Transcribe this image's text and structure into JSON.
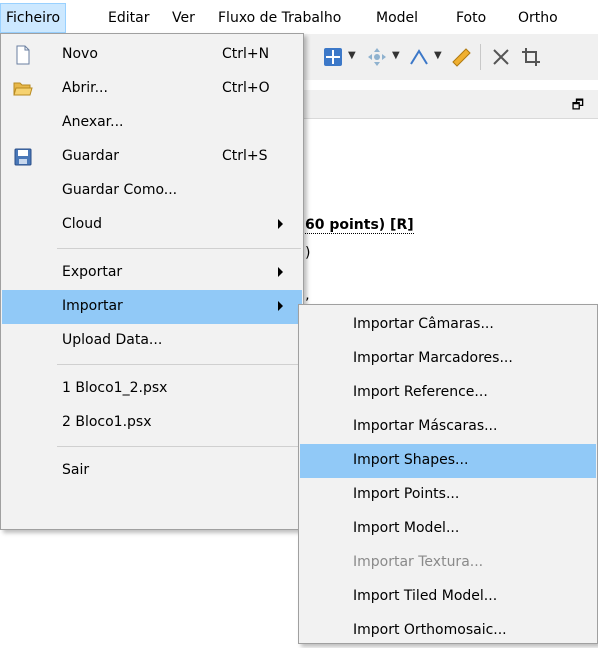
{
  "menubar": {
    "items": [
      "Ficheiro",
      "Editar",
      "Ver",
      "Fluxo de Trabalho",
      "Model",
      "Foto",
      "Ortho"
    ]
  },
  "background": {
    "chunk_label": "60 points) [R]",
    "line2": ")",
    "line3": "’"
  },
  "file_menu": {
    "novo": {
      "label": "Novo",
      "shortcut": "Ctrl+N"
    },
    "abrir": {
      "label": "Abrir...",
      "shortcut": "Ctrl+O"
    },
    "anexar": {
      "label": "Anexar..."
    },
    "guardar": {
      "label": "Guardar",
      "shortcut": "Ctrl+S"
    },
    "guardar_como": {
      "label": "Guardar Como..."
    },
    "cloud": {
      "label": "Cloud"
    },
    "exportar": {
      "label": "Exportar"
    },
    "importar": {
      "label": "Importar"
    },
    "upload": {
      "label": "Upload Data..."
    },
    "recent1": {
      "label": "1 Bloco1_2.psx"
    },
    "recent2": {
      "label": "2 Bloco1.psx"
    },
    "sair": {
      "label": "Sair"
    }
  },
  "import_submenu": {
    "items": [
      "Importar Câmaras...",
      "Importar Marcadores...",
      "Import Reference...",
      "Importar Máscaras...",
      "Import Shapes...",
      "Import Points...",
      "Import Model...",
      "Importar Textura...",
      "Import Tiled Model...",
      "Import Orthomosaic..."
    ]
  },
  "colors": {
    "highlight": "#91c9f7",
    "menubar_active": "#cce8ff",
    "disabled_text": "#8a8a8a"
  }
}
